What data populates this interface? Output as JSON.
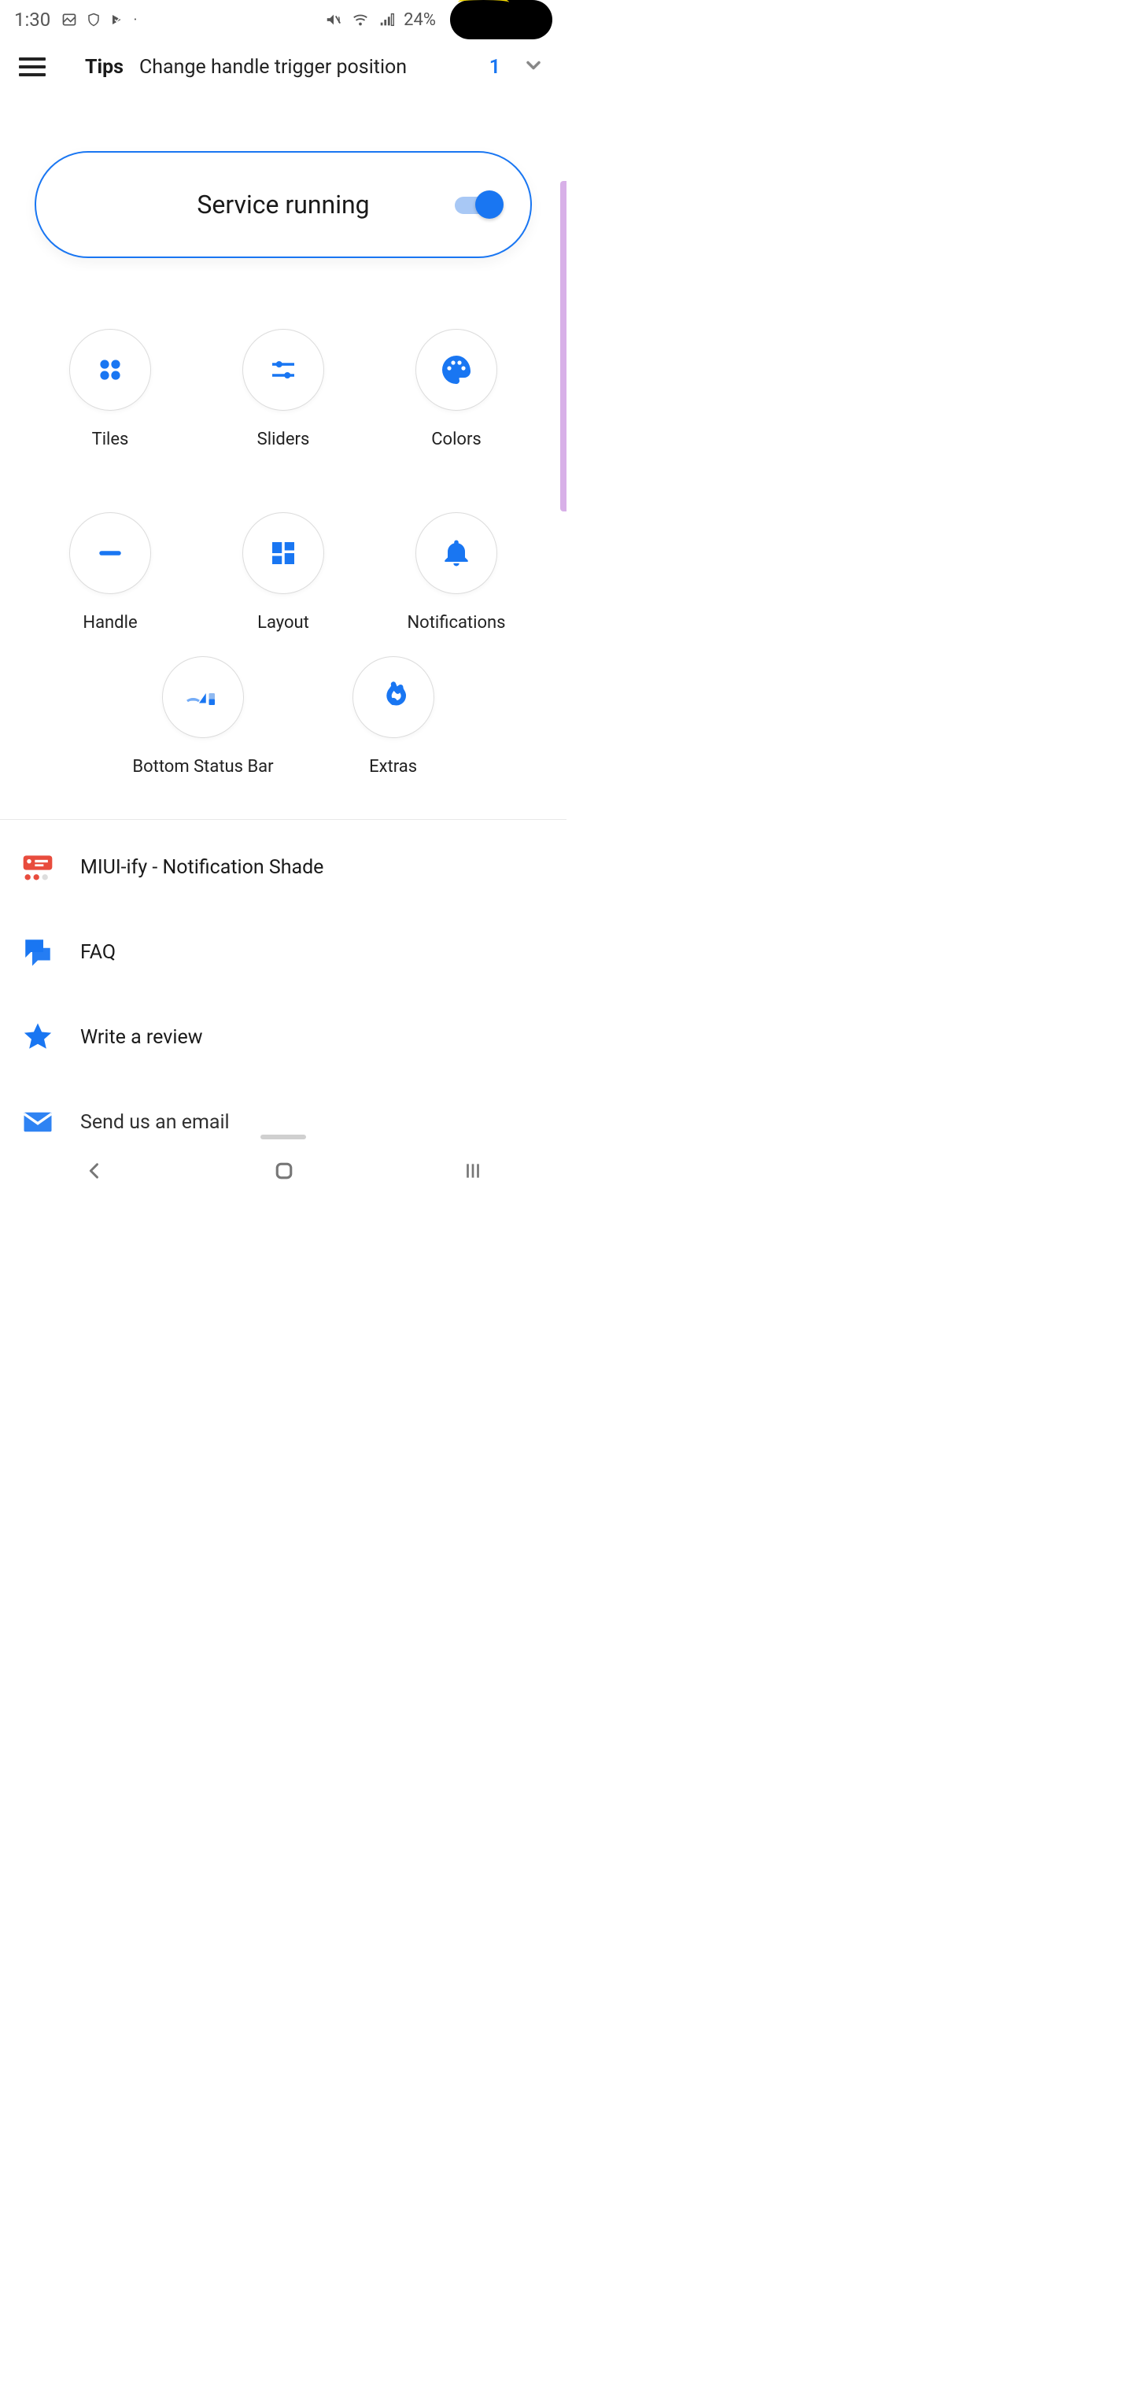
{
  "status": {
    "time": "1:30",
    "battery": "24%"
  },
  "appbar": {
    "tips_label": "Tips",
    "tips_text": "Change handle trigger position",
    "count": "1"
  },
  "service": {
    "label": "Service running",
    "enabled": true
  },
  "grid": [
    {
      "label": "Tiles"
    },
    {
      "label": "Sliders"
    },
    {
      "label": "Colors"
    },
    {
      "label": "Handle"
    },
    {
      "label": "Layout"
    },
    {
      "label": "Notifications"
    }
  ],
  "grid2": [
    {
      "label": "Bottom Status Bar"
    },
    {
      "label": "Extras"
    }
  ],
  "list": [
    {
      "label": "MIUI-ify - Notification Shade"
    },
    {
      "label": "FAQ"
    },
    {
      "label": "Write a review"
    },
    {
      "label": "Send us an email"
    }
  ]
}
